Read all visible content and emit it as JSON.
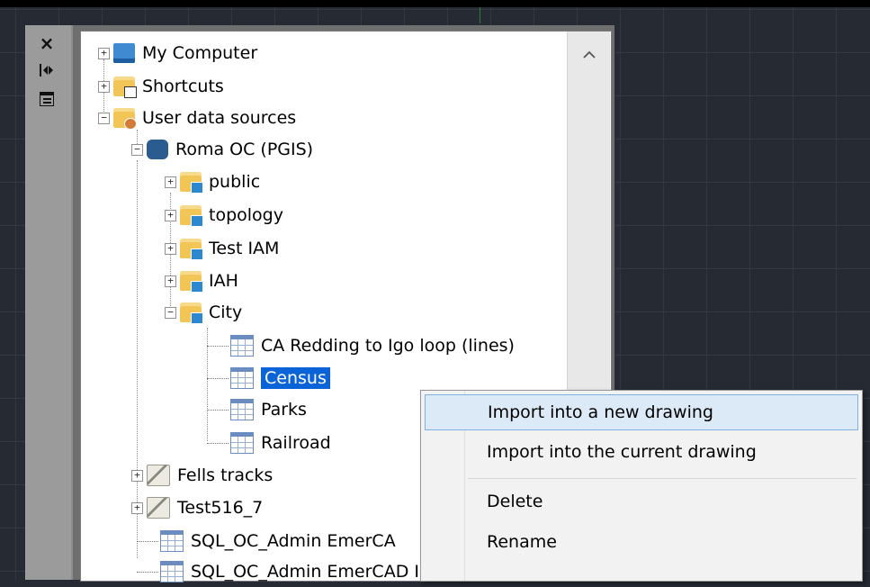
{
  "palette": {
    "close_icon": "×",
    "tree": [
      {
        "label": "My Computer",
        "icon": "computer-icon",
        "expander": "+"
      },
      {
        "label": "Shortcuts",
        "icon": "shortcuts-folder-icon",
        "expander": "+"
      },
      {
        "label": "User data sources",
        "icon": "user-folder-icon",
        "expander": "−"
      },
      {
        "label": "Roma OC (PGIS)",
        "icon": "postgis-database-icon",
        "expander": "−"
      },
      {
        "label": "public",
        "icon": "schema-folder-icon",
        "expander": "+"
      },
      {
        "label": "topology",
        "icon": "schema-folder-icon",
        "expander": "+"
      },
      {
        "label": "Test IAM",
        "icon": "schema-folder-icon",
        "expander": "+"
      },
      {
        "label": "IAH",
        "icon": "schema-folder-icon",
        "expander": "+"
      },
      {
        "label": "City",
        "icon": "schema-folder-icon",
        "expander": "−"
      },
      {
        "label": "CA Redding to Igo loop (lines)",
        "icon": "table-icon"
      },
      {
        "label": "Census",
        "icon": "table-icon",
        "selected": true
      },
      {
        "label": "Parks",
        "icon": "table-icon"
      },
      {
        "label": "Railroad",
        "icon": "table-icon"
      },
      {
        "label": "Fells tracks",
        "icon": "tracks-icon",
        "expander": "+"
      },
      {
        "label": "Test516_7",
        "icon": "tracks-icon",
        "expander": "+"
      },
      {
        "label": "SQL_OC_Admin EmerCA",
        "icon": "table-icon"
      },
      {
        "label": "SQL_OC_Admin EmerCAD IncIWKB (OL",
        "icon": "table-icon"
      }
    ]
  },
  "context_menu": {
    "items": [
      {
        "label": "Import into a new drawing",
        "highlighted": true
      },
      {
        "label": "Import into the current drawing"
      },
      {
        "label": "Delete"
      },
      {
        "label": "Rename"
      }
    ]
  },
  "colors": {
    "selection": "#0a64d8",
    "menu_hover": "#dceaf8",
    "canvas": "#252a33"
  }
}
